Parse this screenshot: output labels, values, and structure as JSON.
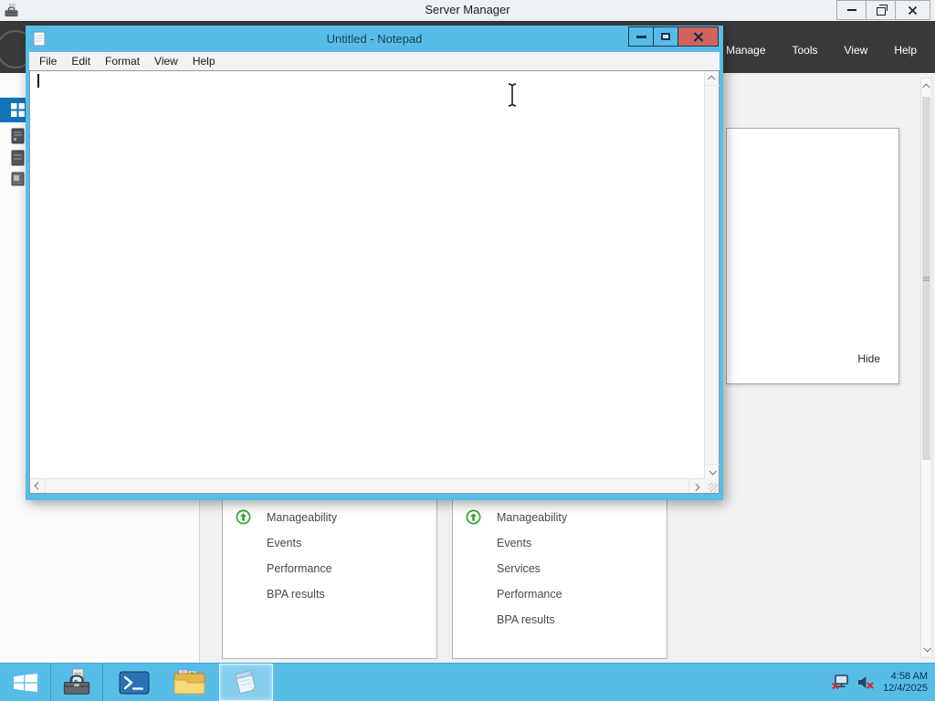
{
  "server_manager": {
    "title": "Server Manager",
    "navbar": {
      "items": [
        "Manage",
        "Tools",
        "View",
        "Help"
      ]
    },
    "dashboard": {
      "tiles": [
        {
          "rows": [
            "Manageability",
            "Events",
            "Performance",
            "BPA results"
          ]
        },
        {
          "rows": [
            "Manageability",
            "Events",
            "Services",
            "Performance",
            "BPA results"
          ]
        }
      ]
    },
    "flyout": {
      "hide_label": "Hide"
    }
  },
  "notepad": {
    "title": "Untitled - Notepad",
    "menu": [
      "File",
      "Edit",
      "Format",
      "View",
      "Help"
    ],
    "content": ""
  },
  "taskbar": {
    "tray": {
      "time": "4:58 AM",
      "date": "12/4/2025"
    }
  },
  "icons": {
    "status_up": "green-circle-up-arrow",
    "network_tray": "network-disconnected-red-x",
    "volume_tray": "volume-muted-red-x",
    "start": "windows-logo"
  },
  "colors": {
    "accent_cyan": "#57bde8",
    "close_button_red": "#d4625c",
    "sidebar_selected_blue": "#1173b8",
    "status_green": "#33a532",
    "navbar_dark": "#3a3a3a"
  }
}
